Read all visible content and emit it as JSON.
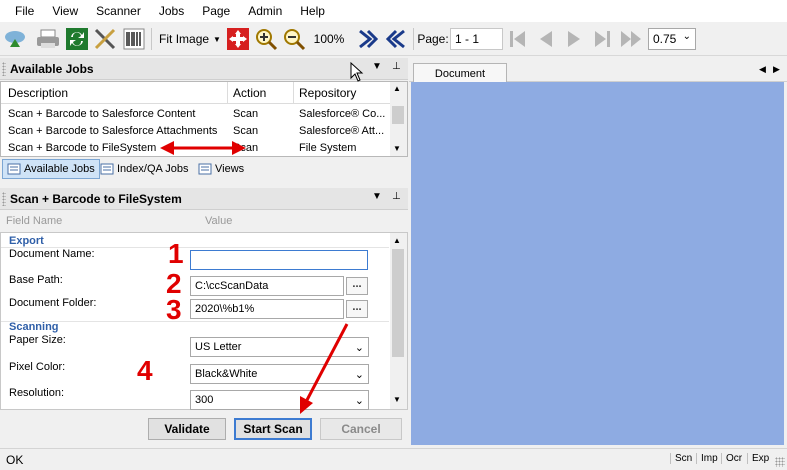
{
  "menu": [
    "File",
    "View",
    "Scanner",
    "Jobs",
    "Page",
    "Admin",
    "Help"
  ],
  "toolbar": {
    "icons": [
      "scan-cloud-icon",
      "printer-icon",
      "refresh-icon",
      "tools-icon",
      "barcode-icon",
      "move-arrows-icon",
      "zoom-in-icon",
      "zoom-out-icon",
      "rotate-right-icon",
      "rotate-left-icon",
      "first-page-icon",
      "prev-page-icon",
      "next-page-icon",
      "last-page-icon",
      "fast-forward-icon"
    ],
    "fit_label": "Fit Image",
    "zoom_percent": "100%",
    "page_label": "Page:",
    "page_value": "1 - 1",
    "scale_value": "0.75"
  },
  "available_jobs": {
    "title": "Available Jobs",
    "columns": [
      "Description",
      "Action",
      "Repository"
    ],
    "rows": [
      {
        "description": "Scan + Barcode to Salesforce Content",
        "action": "Scan",
        "repository": "Salesforce® Co..."
      },
      {
        "description": "Scan + Barcode to Salesforce Attachments",
        "action": "Scan",
        "repository": "Salesforce® Att..."
      },
      {
        "description": "Scan + Barcode to FileSystem",
        "action": "Scan",
        "repository": "File System"
      }
    ]
  },
  "tabs": [
    "Available Jobs",
    "Index/QA Jobs",
    "Views"
  ],
  "job_panel": {
    "title": "Scan + Barcode to FileSystem",
    "col_field": "Field Name",
    "col_value": "Value",
    "sections": {
      "export": "Export",
      "scanning": "Scanning"
    },
    "fields": {
      "document_name_label": "Document Name:",
      "document_name_value": "",
      "base_path_label": "Base Path:",
      "base_path_value": "C:\\ccScanData",
      "document_folder_label": "Document Folder:",
      "document_folder_value": "2020\\%b1%",
      "paper_size_label": "Paper Size:",
      "paper_size_value": "US Letter",
      "pixel_color_label": "Pixel Color:",
      "pixel_color_value": "Black&White",
      "resolution_label": "Resolution:",
      "resolution_value": "300"
    },
    "ellipsis": "..."
  },
  "annotations": [
    "1",
    "2",
    "3",
    "4"
  ],
  "buttons": {
    "validate": "Validate",
    "start_scan": "Start Scan",
    "cancel": "Cancel"
  },
  "document": {
    "tab": "Document",
    "background": "#8eabe2"
  },
  "status": {
    "text": "OK",
    "indicators": [
      "Scn",
      "Imp",
      "Ocr",
      "Exp"
    ]
  },
  "colors": {
    "annotation_red": "#e00000",
    "section_blue": "#2f5fa8",
    "active_tab": "#cfe3f7"
  }
}
